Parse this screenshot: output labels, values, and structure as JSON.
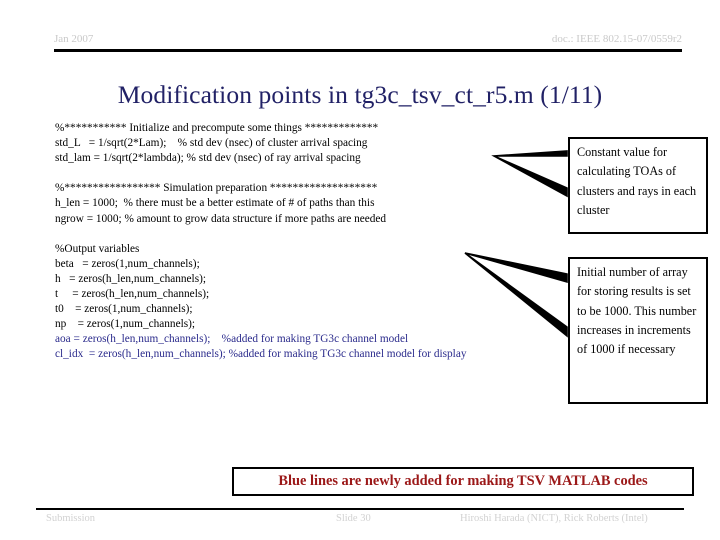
{
  "header": {
    "date": "Jan 2007",
    "doc": "doc.: IEEE 802.15-07/0559r2"
  },
  "title": "Modification points in tg3c_tsv_ct_r5.m (1/11)",
  "code": {
    "lines": [
      {
        "text": "%*********** Initialize and precompute some things *************",
        "blue": false
      },
      {
        "text": "std_L   = 1/sqrt(2*Lam);    % std dev (nsec) of cluster arrival spacing",
        "blue": false
      },
      {
        "text": "std_lam = 1/sqrt(2*lambda); % std dev (nsec) of ray arrival spacing",
        "blue": false
      },
      {
        "text": " ",
        "blue": false
      },
      {
        "text": "%***************** Simulation preparation *******************",
        "blue": false
      },
      {
        "text": "h_len = 1000;  % there must be a better estimate of # of paths than this",
        "blue": false
      },
      {
        "text": "ngrow = 1000; % amount to grow data structure if more paths are needed",
        "blue": false
      },
      {
        "text": " ",
        "blue": false
      },
      {
        "text": "%Output variables",
        "blue": false
      },
      {
        "text": "beta   = zeros(1,num_channels);",
        "blue": false
      },
      {
        "text": "h   = zeros(h_len,num_channels);",
        "blue": false
      },
      {
        "text": "t     = zeros(h_len,num_channels);",
        "blue": false
      },
      {
        "text": "t0    = zeros(1,num_channels);",
        "blue": false
      },
      {
        "text": "np    = zeros(1,num_channels);",
        "blue": false
      },
      {
        "text": "aoa = zeros(h_len,num_channels);    %added for making TG3c channel model",
        "blue": true
      },
      {
        "text": "cl_idx  = zeros(h_len,num_channels); %added for making TG3c channel model for display",
        "blue": true
      }
    ]
  },
  "callouts": [
    {
      "text": "Constant value for calculating TOAs of clusters and rays in each cluster"
    },
    {
      "text": "Initial number of array for storing results is set to be 1000. This number increases in increments of 1000 if necessary"
    }
  ],
  "banner": {
    "text": "Blue lines are newly added for making TSV MATLAB codes",
    "text_color": "#9b1818",
    "border_color": "#000000"
  },
  "footer": {
    "left": "Submission",
    "middle": "Slide 30",
    "right": "Hiroshi Harada (NICT), Rick Roberts (Intel)"
  },
  "colors": {
    "title": "#212166",
    "header_text": "#c9c9c9",
    "blue_code": "#2b2b8c",
    "rule": "#000000"
  }
}
